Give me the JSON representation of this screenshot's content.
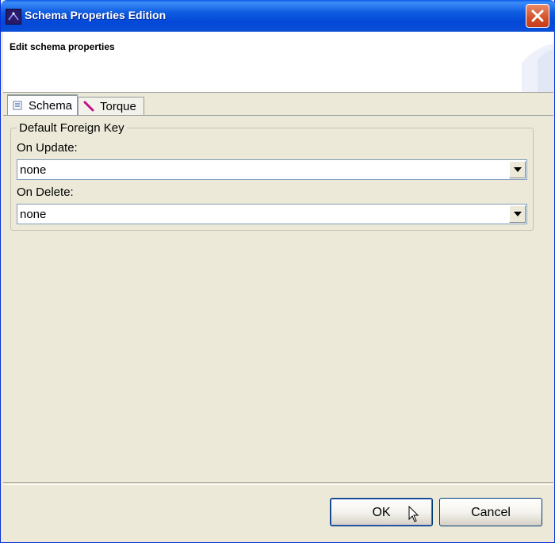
{
  "window": {
    "title": "Schema Properties Edition"
  },
  "banner": {
    "title": "Edit schema properties"
  },
  "tabs": [
    {
      "label": "Schema",
      "icon": "schema-icon",
      "selected": true
    },
    {
      "label": "Torque",
      "icon": "torque-icon",
      "selected": false
    }
  ],
  "group": {
    "title": "Default Foreign Key",
    "on_update": {
      "label": "On Update:",
      "value": "none"
    },
    "on_delete": {
      "label": "On Delete:",
      "value": "none"
    }
  },
  "buttons": {
    "ok": "OK",
    "cancel": "Cancel"
  },
  "colors": {
    "titlebar": "#0a5ce8",
    "dialog_bg": "#ece9d8",
    "close_button": "#d45028"
  }
}
